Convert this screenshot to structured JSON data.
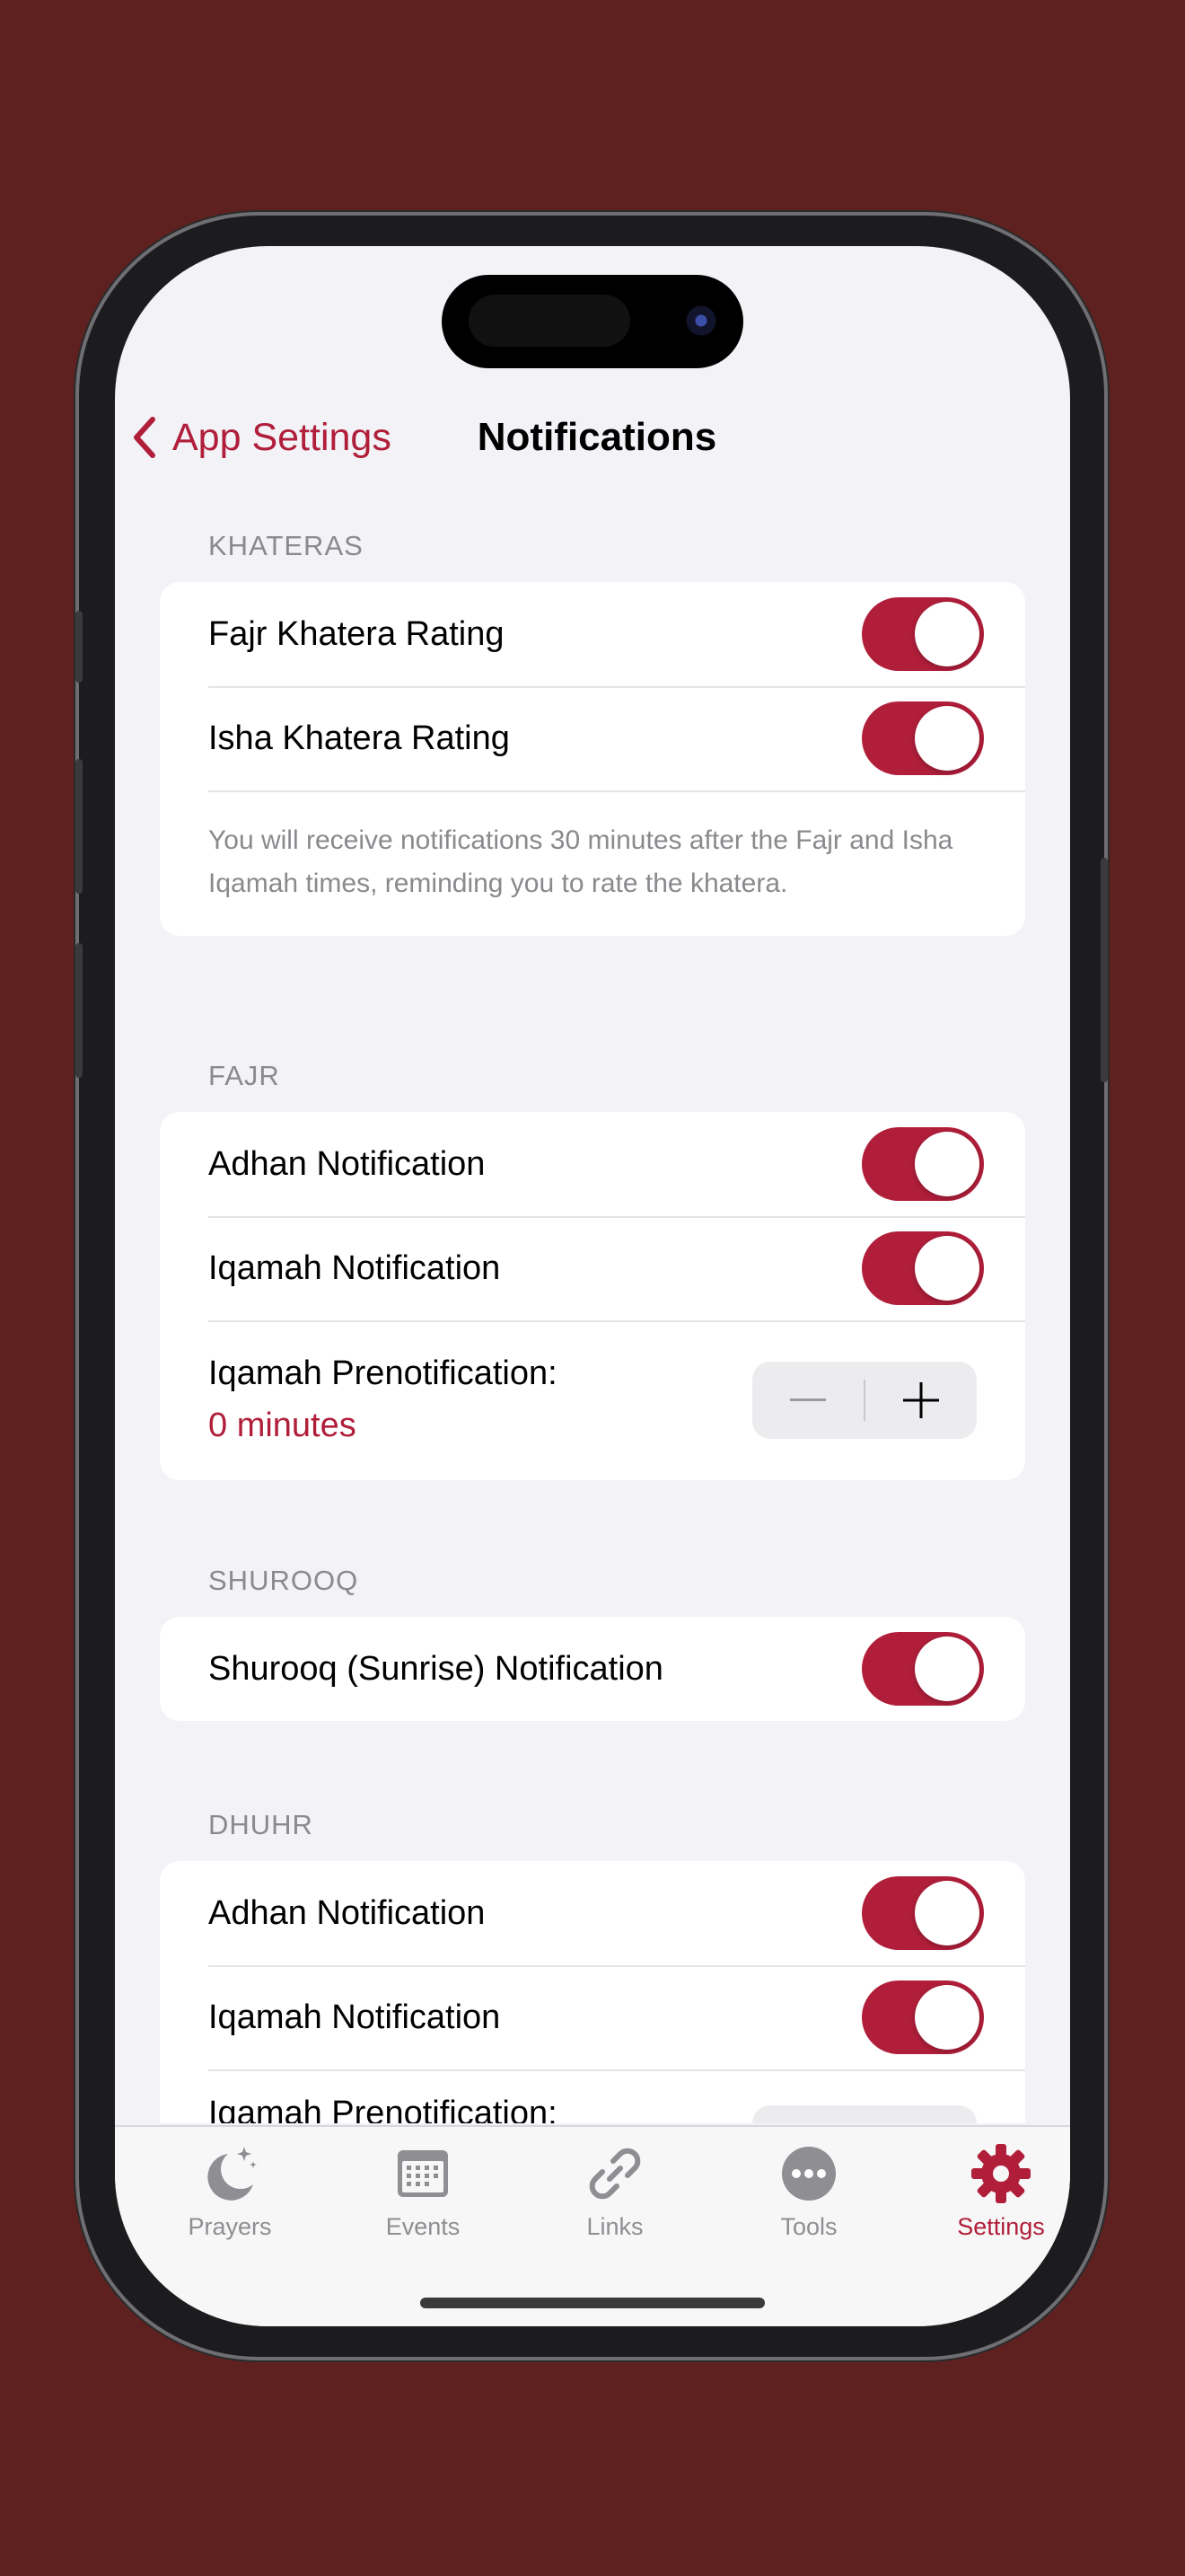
{
  "colors": {
    "accent": "#b01e3a",
    "background": "#5e2120",
    "screen": "#f2f2f7"
  },
  "navbar": {
    "back_label": "App Settings",
    "title": "Notifications"
  },
  "sections": {
    "khateras": {
      "header": "KHATERAS",
      "rows": [
        {
          "label": "Fajr Khatera Rating",
          "on": true
        },
        {
          "label": "Isha Khatera Rating",
          "on": true
        }
      ],
      "note": "You will receive notifications 30 minutes after the Fajr and Isha Iqamah times, reminding you to rate the khatera."
    },
    "fajr": {
      "header": "FAJR",
      "rows": [
        {
          "label": "Adhan Notification",
          "on": true
        },
        {
          "label": "Iqamah Notification",
          "on": true
        }
      ],
      "prenotification": {
        "label": "Iqamah Prenotification:",
        "value": "0 minutes"
      }
    },
    "shurooq": {
      "header": "SHUROOQ",
      "rows": [
        {
          "label": "Shurooq (Sunrise) Notification",
          "on": true
        }
      ]
    },
    "dhuhr": {
      "header": "DHUHR",
      "rows": [
        {
          "label": "Adhan Notification",
          "on": true
        },
        {
          "label": "Iqamah Notification",
          "on": true
        }
      ],
      "prenotification": {
        "label": "Iqamah Prenotification:"
      }
    }
  },
  "tabbar": {
    "items": [
      {
        "label": "Prayers",
        "icon": "moon-stars-icon",
        "active": false
      },
      {
        "label": "Events",
        "icon": "calendar-icon",
        "active": false
      },
      {
        "label": "Links",
        "icon": "link-icon",
        "active": false
      },
      {
        "label": "Tools",
        "icon": "ellipsis-circle-icon",
        "active": false
      },
      {
        "label": "Settings",
        "icon": "gear-icon",
        "active": true
      }
    ]
  }
}
